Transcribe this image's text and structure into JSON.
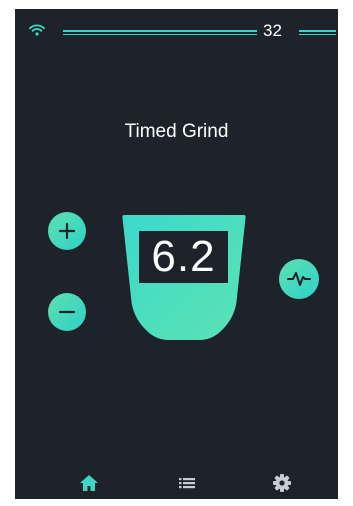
{
  "status": {
    "value": "32"
  },
  "screen": {
    "title": "Timed Grind",
    "display_value": "6.2"
  },
  "controls": {
    "increase_icon": "plus-icon",
    "decrease_icon": "minus-icon",
    "pulse_icon": "pulse-icon"
  },
  "nav": {
    "items": [
      {
        "icon": "home-icon",
        "active": true
      },
      {
        "icon": "list-icon",
        "active": false
      },
      {
        "icon": "gear-icon",
        "active": false
      }
    ]
  },
  "colors": {
    "background": "#1e222a",
    "accent": "#3cd6c4",
    "accent_light": "#5de0b0",
    "nav_active": "#3cd6c4",
    "nav_inactive": "#c8cdd4",
    "text": "#ffffff"
  }
}
